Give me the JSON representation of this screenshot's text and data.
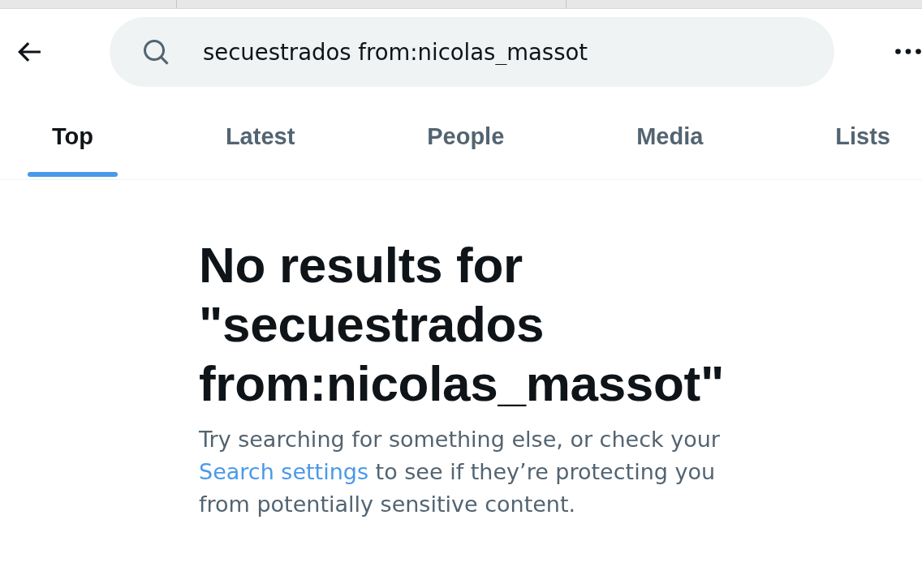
{
  "search": {
    "value": "secuestrados from:nicolas_massot"
  },
  "tabs": [
    {
      "label": "Top",
      "selected": true
    },
    {
      "label": "Latest",
      "selected": false
    },
    {
      "label": "People",
      "selected": false
    },
    {
      "label": "Media",
      "selected": false
    },
    {
      "label": "Lists",
      "selected": false
    }
  ],
  "empty_state": {
    "title": "No results for \"secuestrados from:nicolas_massot\"",
    "message": {
      "before": "Try searching for something else, or check your",
      "link": "Search settings",
      "after": "to see if they’re protecting you from potentially sensitive content."
    }
  }
}
